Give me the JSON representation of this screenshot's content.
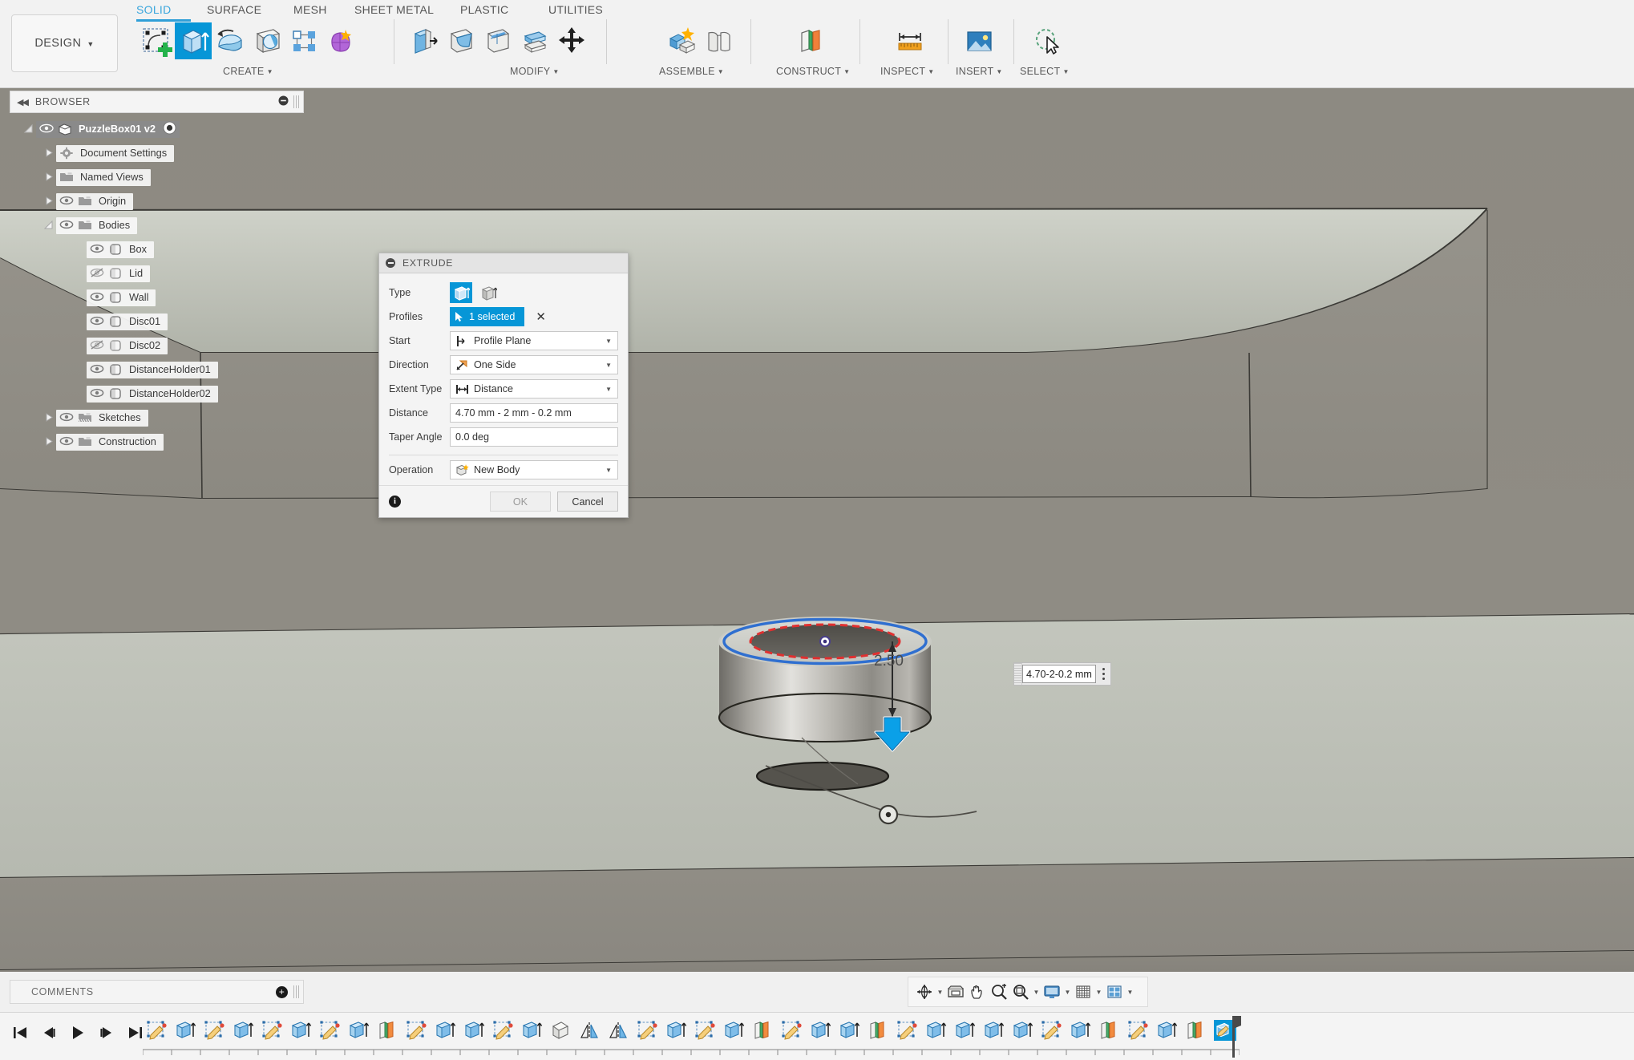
{
  "app": {
    "workspace_label": "DESIGN",
    "tabs": [
      {
        "label": "SOLID",
        "active": true
      },
      {
        "label": "SURFACE",
        "active": false
      },
      {
        "label": "MESH",
        "active": false
      },
      {
        "label": "SHEET METAL",
        "active": false
      },
      {
        "label": "PLASTIC",
        "active": false
      },
      {
        "label": "UTILITIES",
        "active": false
      }
    ],
    "ribbon_groups": [
      {
        "label": "CREATE",
        "caret": true
      },
      {
        "label": "MODIFY",
        "caret": true
      },
      {
        "label": "ASSEMBLE",
        "caret": true
      },
      {
        "label": "CONSTRUCT",
        "caret": true
      },
      {
        "label": "INSPECT",
        "caret": true
      },
      {
        "label": "INSERT",
        "caret": true
      },
      {
        "label": "SELECT",
        "caret": true
      }
    ]
  },
  "browser": {
    "title": "BROWSER",
    "root": {
      "label": "PuzzleBox01 v2",
      "selected": true
    },
    "items": [
      {
        "label": "Document Settings",
        "indent": 1,
        "arrow": "collapsed",
        "eye": "none",
        "icon": "gear-icon"
      },
      {
        "label": "Named Views",
        "indent": 1,
        "arrow": "collapsed",
        "eye": "none",
        "icon": "folder-icon"
      },
      {
        "label": "Origin",
        "indent": 1,
        "arrow": "collapsed",
        "eye": "on",
        "icon": "folder-icon"
      },
      {
        "label": "Bodies",
        "indent": 1,
        "arrow": "expanded",
        "eye": "on",
        "icon": "folder-icon"
      },
      {
        "label": "Box",
        "indent": 2,
        "arrow": "none",
        "eye": "on",
        "icon": "body-icon"
      },
      {
        "label": "Lid",
        "indent": 2,
        "arrow": "none",
        "eye": "off",
        "icon": "body-icon"
      },
      {
        "label": "Wall",
        "indent": 2,
        "arrow": "none",
        "eye": "on",
        "icon": "body-icon"
      },
      {
        "label": "Disc01",
        "indent": 2,
        "arrow": "none",
        "eye": "on",
        "icon": "body-icon"
      },
      {
        "label": "Disc02",
        "indent": 2,
        "arrow": "none",
        "eye": "off",
        "icon": "body-icon"
      },
      {
        "label": "DistanceHolder01",
        "indent": 2,
        "arrow": "none",
        "eye": "on",
        "icon": "body-icon"
      },
      {
        "label": "DistanceHolder02",
        "indent": 2,
        "arrow": "none",
        "eye": "on",
        "icon": "body-icon"
      },
      {
        "label": "Sketches",
        "indent": 1,
        "arrow": "collapsed",
        "eye": "on",
        "icon": "sketch-folder-icon"
      },
      {
        "label": "Construction",
        "indent": 1,
        "arrow": "collapsed",
        "eye": "on",
        "icon": "folder-icon"
      }
    ]
  },
  "extrude_dialog": {
    "title": "EXTRUDE",
    "labels": {
      "type": "Type",
      "profiles": "Profiles",
      "start": "Start",
      "direction": "Direction",
      "extent_type": "Extent Type",
      "distance": "Distance",
      "taper_angle": "Taper Angle",
      "operation": "Operation"
    },
    "values": {
      "profiles": "1 selected",
      "start": "Profile Plane",
      "direction": "One Side",
      "extent_type": "Distance",
      "distance": "4.70 mm - 2 mm - 0.2 mm",
      "taper_angle": "0.0 deg",
      "operation": "New Body"
    },
    "buttons": {
      "ok": "OK",
      "cancel": "Cancel"
    },
    "accent_color": "#0696d7"
  },
  "viewport": {
    "dimension_label": "2.50",
    "dimension_input": "4.70-2-0.2 mm",
    "nav_items": [
      "orbit-icon",
      "orbit-caret",
      "pan-home-icon",
      "pan-icon",
      "zoom-in-icon",
      "zoom-window-icon",
      "zoom-caret",
      "display-settings-icon",
      "display-caret",
      "grid-snaps-icon",
      "grid-caret",
      "viewports-icon",
      "viewports-caret"
    ]
  },
  "comments": {
    "title": "COMMENTS"
  },
  "timeline": {
    "playback": [
      "skip-to-start-icon",
      "step-back-icon",
      "play-icon",
      "step-forward-icon",
      "skip-to-end-icon"
    ],
    "features": [
      "sketch-icon",
      "extrude-icon",
      "sketch-icon",
      "extrude-icon",
      "sketch-icon",
      "extrude-icon",
      "sketch-icon",
      "extrude-icon",
      "plane-icon",
      "sketch-icon",
      "extrude-icon",
      "extrude-icon",
      "sketch-icon",
      "extrude-icon",
      "shell-icon",
      "mirror-icon",
      "mirror-icon",
      "sketch-icon",
      "extrude-icon",
      "sketch-icon",
      "extrude-icon",
      "plane-icon",
      "sketch-icon",
      "extrude-icon",
      "extrude-icon",
      "plane-icon",
      "sketch-icon",
      "extrude-icon",
      "extrude-icon",
      "extrude-icon",
      "extrude-icon",
      "sketch-icon",
      "extrude-icon",
      "plane-icon",
      "sketch-icon",
      "extrude-icon",
      "plane-icon",
      "extrude-active-icon"
    ]
  },
  "colors": {
    "accent": "#0696d7",
    "tab_active": "#3aa6dd",
    "viewport_bg": "#8e8a82",
    "selection_blue": "#2f6fd0",
    "selection_red": "#e03030"
  }
}
